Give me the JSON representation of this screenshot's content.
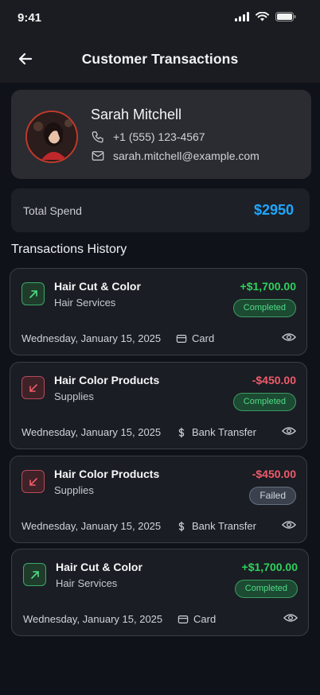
{
  "status_bar": {
    "time": "9:41"
  },
  "header": {
    "title": "Customer Transactions"
  },
  "customer": {
    "name": "Sarah Mitchell",
    "phone": "+1 (555) 123-4567",
    "email": "sarah.mitchell@example.com"
  },
  "summary": {
    "label": "Total Spend",
    "value": "$2950"
  },
  "history": {
    "title": "Transactions History",
    "items": [
      {
        "title": "Hair Cut & Color",
        "category": "Hair Services",
        "amount": "+$1,700.00",
        "status": "Completed",
        "date": "Wednesday, January 15, 2025",
        "method": "Card",
        "direction": "up"
      },
      {
        "title": "Hair Color Products",
        "category": "Supplies",
        "amount": "-$450.00",
        "status": "Completed",
        "date": "Wednesday, January 15, 2025",
        "method": "Bank Transfer",
        "direction": "down"
      },
      {
        "title": "Hair Color Products",
        "category": "Supplies",
        "amount": "-$450.00",
        "status": "Failed",
        "date": "Wednesday, January 15, 2025",
        "method": "Bank Transfer",
        "direction": "down"
      },
      {
        "title": "Hair Cut & Color",
        "category": "Hair Services",
        "amount": "+$1,700.00",
        "status": "Completed",
        "date": "Wednesday, January 15, 2025",
        "method": "Card",
        "direction": "up"
      }
    ]
  },
  "colors": {
    "accent_blue": "#1ea7ff",
    "positive": "#2fd15d",
    "negative": "#ef5a6a",
    "background": "#0f1319"
  },
  "icons": [
    "back-arrow-icon",
    "phone-icon",
    "mail-icon",
    "arrow-up-right-icon",
    "arrow-down-left-icon",
    "card-icon",
    "dollar-icon",
    "eye-icon",
    "signal-icon",
    "wifi-icon",
    "battery-icon"
  ]
}
